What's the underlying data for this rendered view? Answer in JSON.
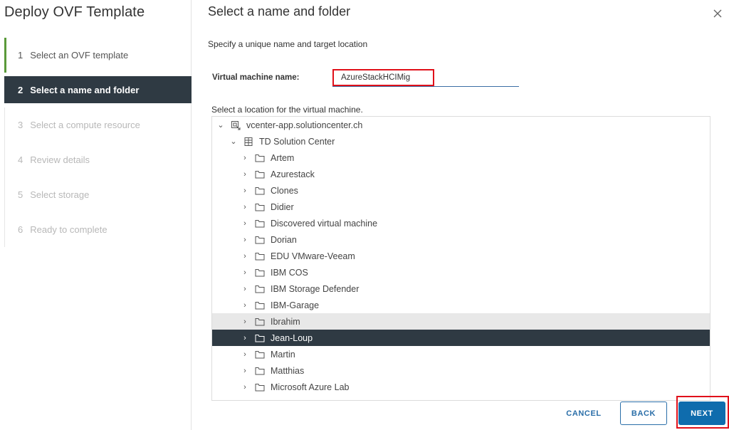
{
  "wizard": {
    "title": "Deploy OVF Template",
    "steps": [
      {
        "num": "1",
        "label": "Select an OVF template",
        "state": "done"
      },
      {
        "num": "2",
        "label": "Select a name and folder",
        "state": "active"
      },
      {
        "num": "3",
        "label": "Select a compute resource",
        "state": "disabled"
      },
      {
        "num": "4",
        "label": "Review details",
        "state": "disabled"
      },
      {
        "num": "5",
        "label": "Select storage",
        "state": "disabled"
      },
      {
        "num": "6",
        "label": "Ready to complete",
        "state": "disabled"
      }
    ]
  },
  "page": {
    "title": "Select a name and folder",
    "subtitle": "Specify a unique name and target location",
    "close_icon": "close-icon"
  },
  "vm_name": {
    "label": "Virtual machine name:",
    "value": "AzureStackHCIMig"
  },
  "location": {
    "label": "Select a location for the virtual machine.",
    "vcenter": {
      "label": "vcenter-app.solutioncenter.ch",
      "icon": "vcenter-icon",
      "expanded": true
    },
    "datacenter": {
      "label": "TD Solution Center",
      "icon": "datacenter-icon",
      "expanded": true
    },
    "folders": [
      {
        "label": "Artem",
        "state": ""
      },
      {
        "label": "Azurestack",
        "state": ""
      },
      {
        "label": "Clones",
        "state": ""
      },
      {
        "label": "Didier",
        "state": ""
      },
      {
        "label": "Discovered virtual machine",
        "state": ""
      },
      {
        "label": "Dorian",
        "state": ""
      },
      {
        "label": "EDU VMware-Veeam",
        "state": ""
      },
      {
        "label": "IBM COS",
        "state": ""
      },
      {
        "label": "IBM Storage Defender",
        "state": ""
      },
      {
        "label": "IBM-Garage",
        "state": ""
      },
      {
        "label": "Ibrahim",
        "state": "hover"
      },
      {
        "label": "Jean-Loup",
        "state": "selected"
      },
      {
        "label": "Martin",
        "state": ""
      },
      {
        "label": "Matthias",
        "state": ""
      },
      {
        "label": "Microsoft Azure Lab",
        "state": ""
      }
    ]
  },
  "footer": {
    "cancel_label": "CANCEL",
    "back_label": "BACK",
    "next_label": "NEXT"
  },
  "colors": {
    "accent": "#0f6cad",
    "selected_bg": "#2f3a43",
    "highlight_red": "#e0101a",
    "done_green": "#5a9a3a"
  }
}
